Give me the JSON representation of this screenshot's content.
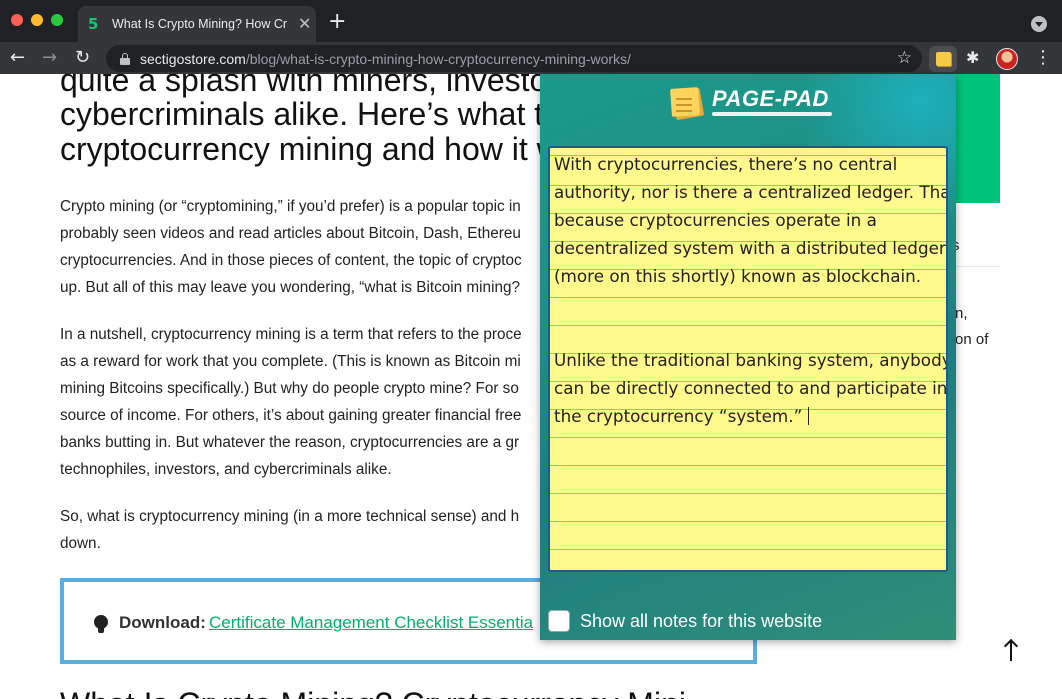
{
  "browser": {
    "tab": {
      "title": "What Is Crypto Mining? How Cr",
      "favicon": "5",
      "close_glyph": "✕"
    },
    "new_tab_glyph": "+",
    "nav": {
      "back": "←",
      "forward": "→",
      "reload": "↻"
    },
    "address": {
      "host": "sectigostore.com",
      "path": "/blog/what-is-crypto-mining-how-cryptocurrency-mining-works/"
    },
    "star_glyph": "☆",
    "extensions_glyph": "✱",
    "menu_glyph": "⋮"
  },
  "article": {
    "heading_lines": [
      "quite a splash with miners, investo",
      "cybercriminals alike. Here’s what t",
      "cryptocurrency mining and how it w"
    ],
    "paragraph1": [
      "Crypto mining (or “cryptomining,” if you’d prefer) is a popular topic in",
      "probably seen videos and read articles about Bitcoin, Dash, Ethereu",
      "cryptocurrencies. And in those pieces of content, the topic of cryptoc",
      "up. But all of this may leave you wondering, “what is Bitcoin mining?"
    ],
    "paragraph2": [
      "In a nutshell, cryptocurrency mining is a term that refers to the proce",
      "as a reward for work that you complete. (This is known as Bitcoin mi",
      "mining Bitcoins specifically.) But why do people crypto mine? For so",
      "source of income. For others, it’s about gaining greater financial free",
      "banks butting in. But whatever the reason, cryptocurrencies are a gr",
      "technophiles, investors, and cybercriminals alike."
    ],
    "paragraph3": [
      "So, what is cryptocurrency mining (in a more technical sense) and h",
      "down."
    ],
    "download": {
      "label": "Download:",
      "link": "Certificate Management Checklist Essentia"
    },
    "next_heading": "What Is Crypto Mining? Cryptocurrency Mini",
    "sidebar_fragments": {
      "s": "s",
      "n": "n,",
      "on_of": "on of"
    }
  },
  "page_pad": {
    "title": "PAGE-PAD",
    "note_lines": [
      "With cryptocurrencies, there’s no central",
      "authority, nor is there a centralized ledger. That’s",
      "because cryptocurrencies operate in a",
      "decentralized system with a distributed ledger",
      "(more on this shortly) known as blockchain.",
      "",
      "",
      "Unlike the traditional banking system, anybody",
      "can be directly connected to and participate in",
      "the cryptocurrency “system.”"
    ],
    "show_all_label": "Show all notes for this website",
    "show_all_checked": false,
    "colors": {
      "note_bg": "#fef98b",
      "panel": "#1f8f87"
    }
  }
}
